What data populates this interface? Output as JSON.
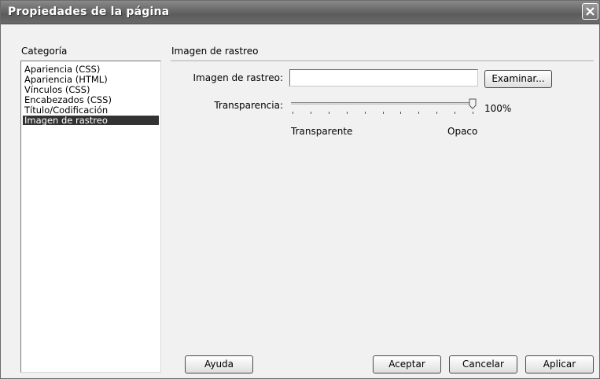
{
  "window": {
    "title": "Propiedades de la página"
  },
  "sidebar": {
    "label": "Categoría",
    "items": [
      {
        "label": "Apariencia (CSS)",
        "selected": false
      },
      {
        "label": "Apariencia (HTML)",
        "selected": false
      },
      {
        "label": "Vínculos (CSS)",
        "selected": false
      },
      {
        "label": "Encabezados (CSS)",
        "selected": false
      },
      {
        "label": "Título/Codificación",
        "selected": false
      },
      {
        "label": "Imagen de rastreo",
        "selected": true
      }
    ]
  },
  "panel": {
    "title": "Imagen de rastreo",
    "image_label": "Imagen de rastreo:",
    "image_value": "",
    "browse_label": "Examinar...",
    "transparency_label": "Transparencia:",
    "transparency_percent": 100,
    "transparency_text": "100%",
    "min_label": "Transparente",
    "max_label": "Opaco"
  },
  "footer": {
    "help_label": "Ayuda",
    "ok_label": "Aceptar",
    "cancel_label": "Cancelar",
    "apply_label": "Aplicar"
  },
  "colors": {
    "selection": "#333333",
    "titlebar": "#6e6e6e"
  }
}
